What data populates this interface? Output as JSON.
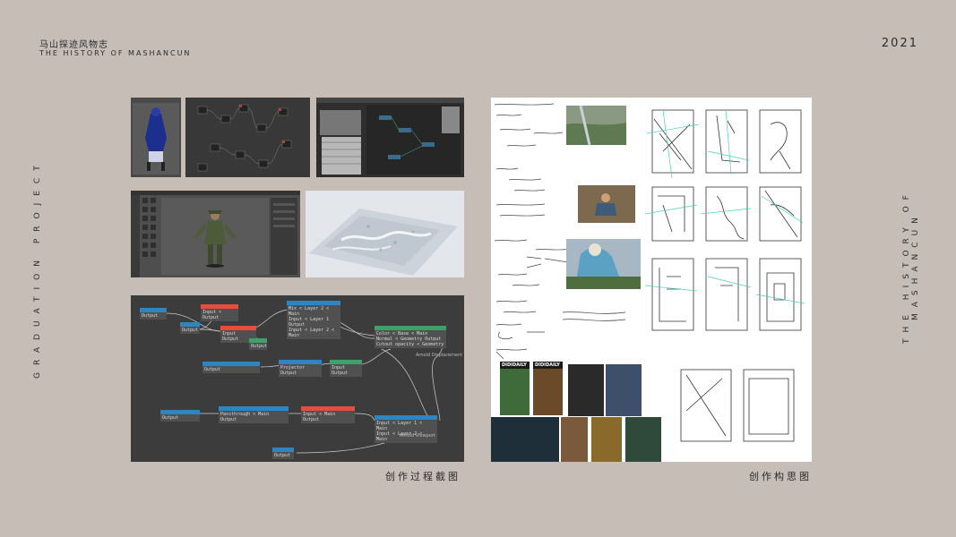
{
  "header": {
    "title_cn": "马山探迹风物志",
    "title_en": "THE HISTORY OF MASHANCUN",
    "year": "2021"
  },
  "side": {
    "left_vertical": "GRADUATION PROJECT",
    "right_vertical": "THE HISTORY OF MASHANCUN"
  },
  "captions": {
    "left": "创作过程截图",
    "right": "创作构思图"
  },
  "graph": {
    "label_displacement": "Arnold Displacement",
    "label_viewport": "Arnold Viewport",
    "output": "Output"
  },
  "magazine": {
    "brand_1": "DIDIDAILY",
    "brand_2": "DIDIDAILY"
  },
  "colors": {
    "background": "#c6bdb7",
    "text": "#2b2b2b"
  }
}
